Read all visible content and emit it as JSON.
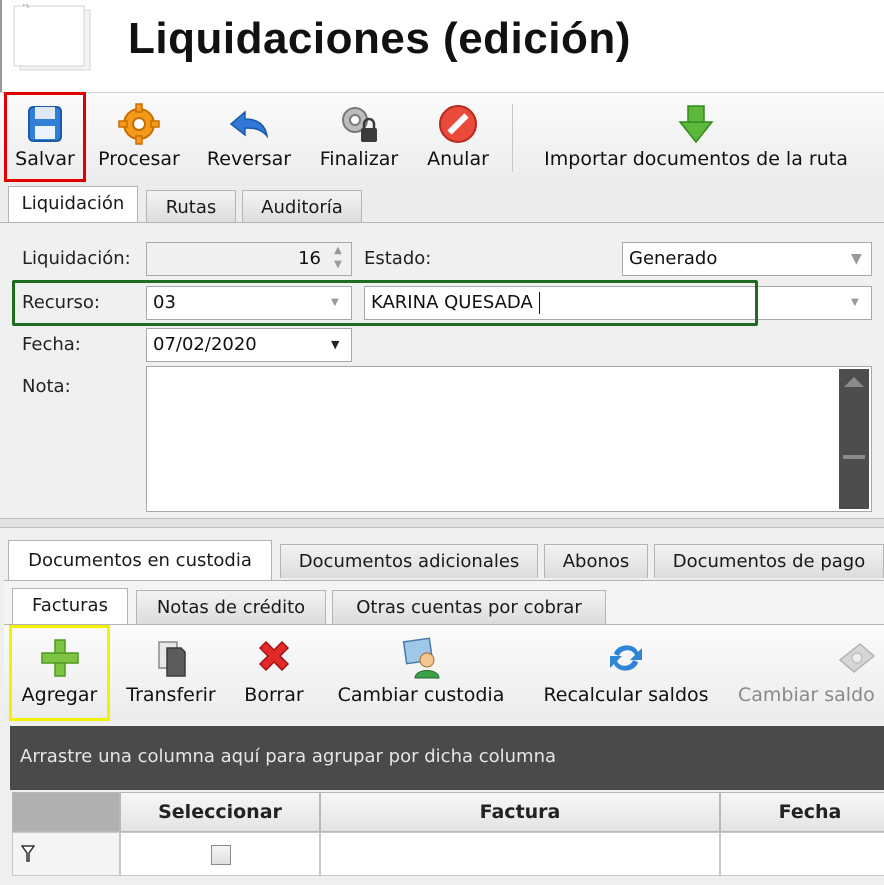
{
  "title": "Liquidaciones (edición)",
  "toolbar": {
    "save": "Salvar",
    "process": "Procesar",
    "reverse": "Reversar",
    "finalize": "Finalizar",
    "cancel": "Anular",
    "import": "Importar documentos de la ruta"
  },
  "main_tabs": [
    "Liquidación",
    "Rutas",
    "Auditoría"
  ],
  "form": {
    "liquidacion_label": "Liquidación:",
    "liquidacion_value": "16",
    "estado_label": "Estado:",
    "estado_value": "Generado",
    "recurso_label": "Recurso:",
    "recurso_code": "03",
    "recurso_name": "KARINA QUESADA",
    "fecha_label": "Fecha:",
    "fecha_value": "07/02/2020",
    "nota_label": "Nota:",
    "nota_value": ""
  },
  "doc_tabs": [
    "Documentos en custodia",
    "Documentos adicionales",
    "Abonos",
    "Documentos de pago"
  ],
  "sub_tabs": [
    "Facturas",
    "Notas de crédito",
    "Otras cuentas por cobrar"
  ],
  "sub_toolbar": {
    "add": "Agregar",
    "transfer": "Transferir",
    "delete": "Borrar",
    "change_custody": "Cambiar custodia",
    "recalc": "Recalcular saldos",
    "change_balance": "Cambiar saldo"
  },
  "group_panel_text": "Arrastre una columna aquí para agrupar por dicha columna",
  "grid": {
    "columns": [
      "Seleccionar",
      "Factura",
      "Fecha"
    ]
  },
  "colors": {
    "save_highlight": "#e10000",
    "resource_highlight": "#1f6b1f",
    "add_highlight": "#f2f200"
  }
}
